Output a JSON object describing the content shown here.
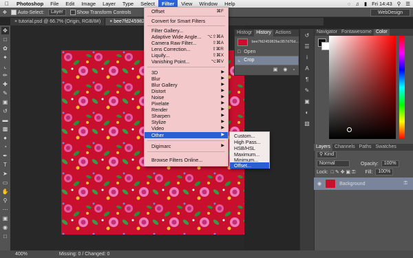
{
  "menubar": {
    "app": "Photoshop",
    "items": [
      "File",
      "Edit",
      "Image",
      "Layer",
      "Type",
      "Select",
      "Filter",
      "View",
      "Window",
      "Help"
    ],
    "active": "Filter",
    "clock": "Fri 14:43"
  },
  "options_bar": {
    "auto_select_label": "Auto-Select:",
    "auto_select_value": "Layer",
    "show_transform_label": "Show Transform Controls",
    "workspace": "WebDesign"
  },
  "tabs": [
    {
      "label": "tutorial.psd @ 66.7% (Origin, RGB/8#)",
      "active": false
    },
    {
      "label": "bee7fd245982fac957d",
      "active": true
    }
  ],
  "filter_menu": {
    "items": [
      {
        "label": "Offset",
        "shortcut": "⌘F"
      },
      {
        "label": "Convert for Smart Filters",
        "shortcut": ""
      },
      {
        "label": "Filter Gallery...",
        "shortcut": ""
      },
      {
        "label": "Adaptive Wide Angle...",
        "shortcut": "⌥⇧⌘A"
      },
      {
        "label": "Camera Raw Filter...",
        "shortcut": "⇧⌘A"
      },
      {
        "label": "Lens Correction...",
        "shortcut": "⇧⌘R"
      },
      {
        "label": "Liquify...",
        "shortcut": "⇧⌘X"
      },
      {
        "label": "Vanishing Point...",
        "shortcut": "⌥⌘V"
      },
      {
        "label": "3D",
        "shortcut": ""
      },
      {
        "label": "Blur",
        "shortcut": ""
      },
      {
        "label": "Blur Gallery",
        "shortcut": ""
      },
      {
        "label": "Distort",
        "shortcut": ""
      },
      {
        "label": "Noise",
        "shortcut": ""
      },
      {
        "label": "Pixelate",
        "shortcut": ""
      },
      {
        "label": "Render",
        "shortcut": ""
      },
      {
        "label": "Sharpen",
        "shortcut": ""
      },
      {
        "label": "Stylize",
        "shortcut": ""
      },
      {
        "label": "Video",
        "shortcut": ""
      },
      {
        "label": "Other",
        "shortcut": ""
      },
      {
        "label": "Digimarc",
        "shortcut": ""
      },
      {
        "label": "Browse Filters Online...",
        "shortcut": ""
      }
    ]
  },
  "other_menu": {
    "items": [
      "Custom...",
      "High Pass...",
      "HSB/HSL",
      "Maximum...",
      "Minimum...",
      "Offset..."
    ],
    "highlighted": "Offset..."
  },
  "history_panel": {
    "tabs": [
      "Histogr",
      "History",
      "Actions"
    ],
    "snapshot": "bee7fd245982fac957d76d...",
    "states": [
      "Open",
      "Crop"
    ]
  },
  "right_panel": {
    "top_tabs": [
      "Navigator",
      "Fontawesome",
      "Color"
    ],
    "layer_tabs": [
      "Layers",
      "Channels",
      "Paths",
      "Swatches"
    ],
    "kind_label": "Kind",
    "blend_mode": "Normal",
    "opacity_label": "Opacity:",
    "opacity_value": "100%",
    "lock_label": "Lock:",
    "fill_label": "Fill:",
    "fill_value": "100%",
    "layer_name": "Background"
  },
  "statusbar": {
    "zoom": "400%",
    "info": "Missing: 0 / Changed: 0"
  },
  "colors": {
    "highlight": "#2a5fd3",
    "fabric_red": "#c8102e"
  }
}
